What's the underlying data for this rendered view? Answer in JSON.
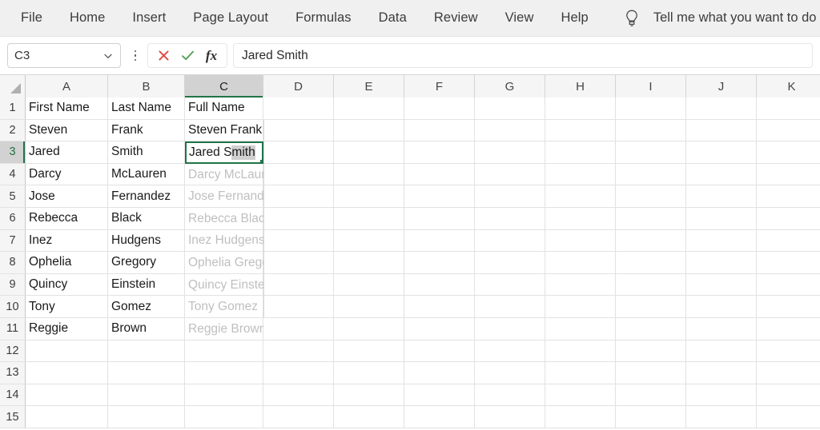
{
  "ribbon": {
    "tabs": [
      {
        "label": "File"
      },
      {
        "label": "Home"
      },
      {
        "label": "Insert"
      },
      {
        "label": "Page Layout"
      },
      {
        "label": "Formulas"
      },
      {
        "label": "Data"
      },
      {
        "label": "Review"
      },
      {
        "label": "View"
      },
      {
        "label": "Help"
      }
    ],
    "tell_me": {
      "icon": "lightbulb-icon",
      "placeholder": "Tell me what you want to do"
    }
  },
  "formula_bar": {
    "name_box_value": "C3",
    "name_box_dropdown_icon": "chevron-down-icon",
    "more_options_icon": "vertical-ellipsis-icon",
    "cancel_icon": "cancel-x-icon",
    "enter_icon": "enter-check-icon",
    "function_icon": "fx-insert-function-icon",
    "function_label": "fx",
    "formula_value": "Jared Smith"
  },
  "grid": {
    "select_all_icon": "select-all-triangle-icon",
    "active_cell": "C3",
    "active_column": "C",
    "active_row": "3",
    "accent_color": "#217346",
    "ghost_color": "#bfbfbf",
    "columns": [
      {
        "label": "A",
        "width": 103
      },
      {
        "label": "B",
        "width": 96
      },
      {
        "label": "C",
        "width": 98
      },
      {
        "label": "D",
        "width": 88
      },
      {
        "label": "E",
        "width": 88
      },
      {
        "label": "F",
        "width": 88
      },
      {
        "label": "G",
        "width": 88
      },
      {
        "label": "H",
        "width": 88
      },
      {
        "label": "I",
        "width": 88
      },
      {
        "label": "J",
        "width": 88
      },
      {
        "label": "K",
        "width": 88
      }
    ],
    "rows": [
      {
        "num": "1",
        "a": "First Name",
        "b": "Last Name",
        "c": "Full Name",
        "c_state": "normal"
      },
      {
        "num": "2",
        "a": "Steven",
        "b": "Frank",
        "c": "Steven Frank",
        "c_state": "normal"
      },
      {
        "num": "3",
        "a": "Jared",
        "b": "Smith",
        "c": "Jared Smith",
        "c_state": "selected"
      },
      {
        "num": "4",
        "a": "Darcy",
        "b": "McLauren",
        "c": "Darcy McLauren",
        "c_state": "ghost"
      },
      {
        "num": "5",
        "a": "Jose",
        "b": "Fernandez",
        "c": "Jose Fernandez",
        "c_state": "ghost"
      },
      {
        "num": "6",
        "a": "Rebecca",
        "b": "Black",
        "c": "Rebecca Black",
        "c_state": "ghost"
      },
      {
        "num": "7",
        "a": "Inez",
        "b": "Hudgens",
        "c": "Inez Hudgens",
        "c_state": "ghost"
      },
      {
        "num": "8",
        "a": "Ophelia",
        "b": "Gregory",
        "c": "Ophelia Gregory",
        "c_state": "ghost"
      },
      {
        "num": "9",
        "a": "Quincy",
        "b": "Einstein",
        "c": "Quincy Einstein",
        "c_state": "ghost"
      },
      {
        "num": "10",
        "a": "Tony",
        "b": "Gomez",
        "c": "Tony Gomez",
        "c_state": "ghost"
      },
      {
        "num": "11",
        "a": "Reggie",
        "b": "Brown",
        "c": "Reggie Brown",
        "c_state": "ghost"
      },
      {
        "num": "12",
        "a": "",
        "b": "",
        "c": "",
        "c_state": "normal"
      },
      {
        "num": "13",
        "a": "",
        "b": "",
        "c": "",
        "c_state": "normal"
      },
      {
        "num": "14",
        "a": "",
        "b": "",
        "c": "",
        "c_state": "normal"
      },
      {
        "num": "15",
        "a": "",
        "b": "",
        "c": "",
        "c_state": "normal"
      }
    ],
    "selected_cell_text_prefix": "Jared S",
    "selected_cell_text_highlight": "mith"
  }
}
